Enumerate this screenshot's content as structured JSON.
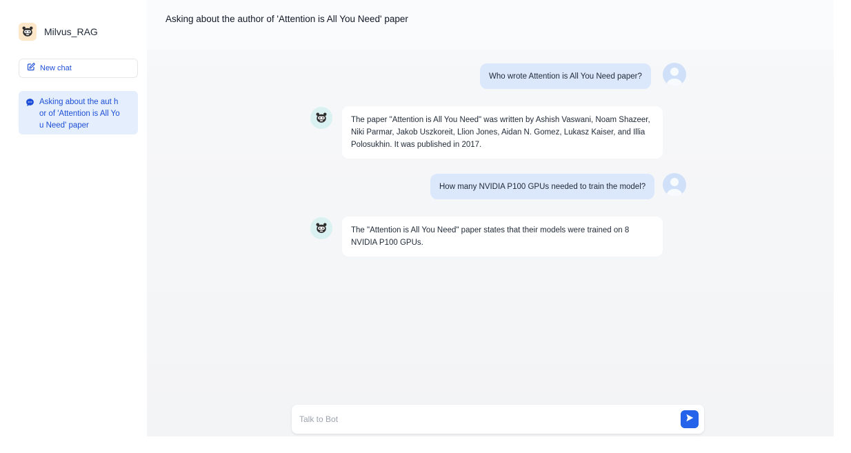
{
  "app": {
    "name": "Milvus_RAG",
    "logo_icon": "bot-logo-icon"
  },
  "sidebar": {
    "new_chat_label": "New chat",
    "new_chat_icon": "edit-icon",
    "conversations": [
      {
        "label": "Asking about the aut hor of 'Attention is All You Need' paper",
        "icon": "chat-bubble-icon",
        "active": true
      }
    ]
  },
  "header": {
    "title": "Asking about the author of 'Attention is All You Need' paper"
  },
  "messages": [
    {
      "role": "user",
      "text": "Who wrote Attention is All You Need paper?"
    },
    {
      "role": "bot",
      "text": "The paper \"Attention is All You Need\" was written by Ashish Vaswani, Noam Shazeer, Niki Parmar, Jakob Uszkoreit, Llion Jones, Aidan N. Gomez, Lukasz Kaiser, and Illia Polosukhin. It was published in 2017."
    },
    {
      "role": "user",
      "text": "How many NVIDIA P100 GPUs needed to train the model?"
    },
    {
      "role": "bot",
      "text": "The \"Attention is All You Need\" paper states that their models were trained on 8 NVIDIA P100 GPUs."
    }
  ],
  "composer": {
    "placeholder": "Talk to Bot",
    "value": "",
    "send_icon": "send-icon"
  },
  "colors": {
    "accent": "#2563eb",
    "user_bubble": "#dbe8fb",
    "active_item": "#e4eefc",
    "bot_avatar_bg": "#d9f1f0"
  }
}
